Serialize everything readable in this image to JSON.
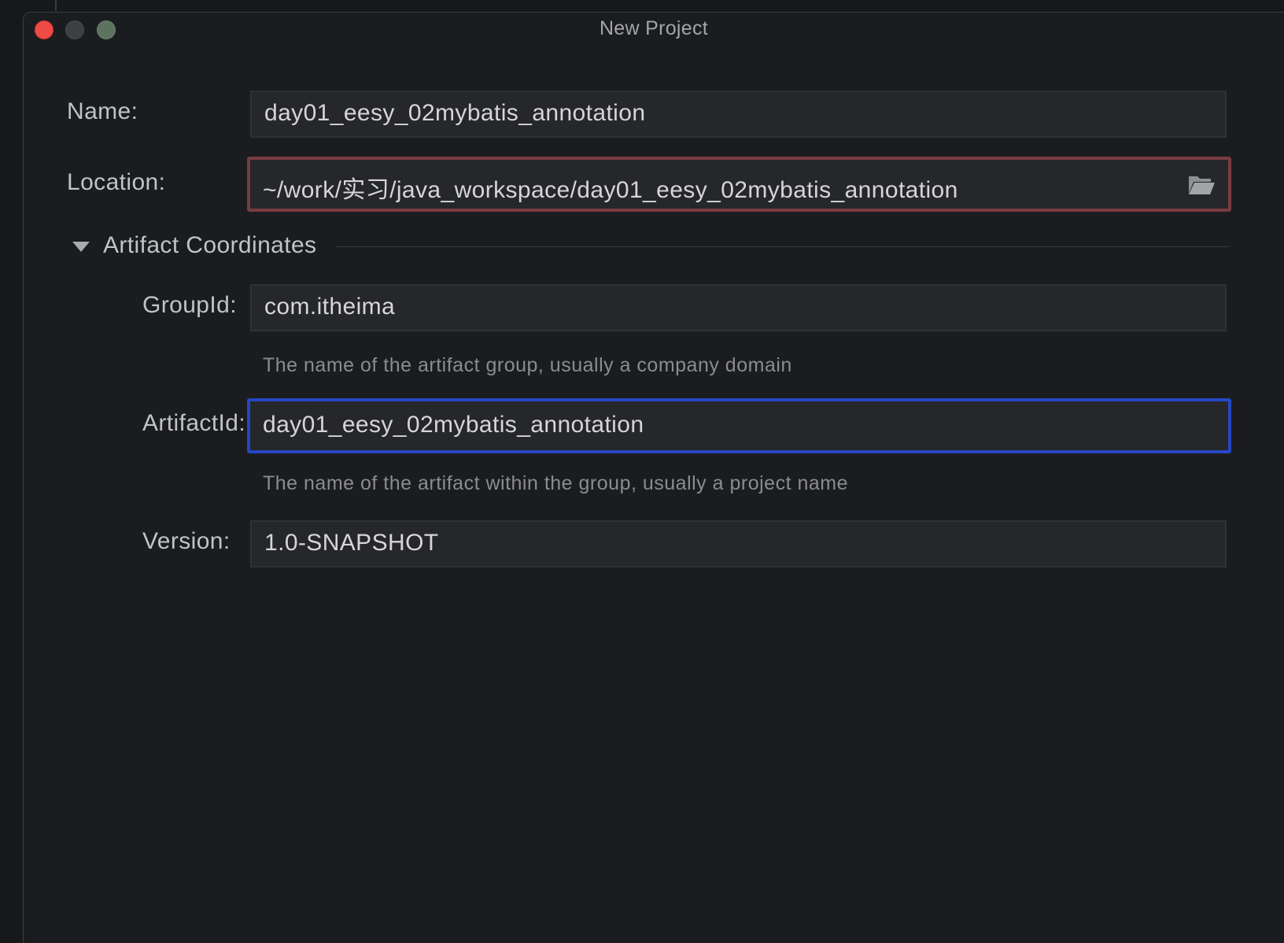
{
  "window": {
    "title": "New Project"
  },
  "form": {
    "name": {
      "label": "Name:",
      "value": "day01_eesy_02mybatis_annotation"
    },
    "location": {
      "label": "Location:",
      "value": "~/work/实习/java_workspace/day01_eesy_02mybatis_annotation",
      "state": "error",
      "browse_icon": "folder-open-icon"
    },
    "artifact_section": {
      "title": "Artifact Coordinates",
      "expanded": true
    },
    "group_id": {
      "label": "GroupId:",
      "value": "com.itheima",
      "hint": "The name of the artifact group, usually a company domain"
    },
    "artifact_id": {
      "label": "ArtifactId:",
      "value": "day01_eesy_02mybatis_annotation",
      "hint": "The name of the artifact within the group, usually a project name",
      "state": "focused"
    },
    "version": {
      "label": "Version:",
      "value": "1.0-SNAPSHOT"
    }
  },
  "colors": {
    "window_bg": "#1b1c1f",
    "field_bg": "#26272a",
    "error_border": "#7a3d40",
    "focus_border": "#2547c4",
    "close_button": "#ee4b45",
    "maximize_button": "#5d7360"
  }
}
